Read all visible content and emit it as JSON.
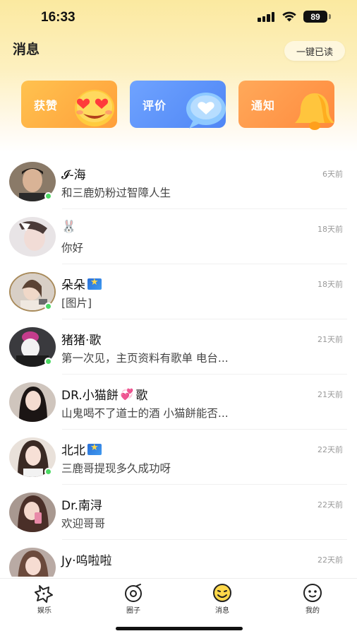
{
  "status_bar": {
    "time": "16:33",
    "battery": "89"
  },
  "header": {
    "title": "消息",
    "read_all_label": "一键已读"
  },
  "cards": [
    {
      "label": "获赞"
    },
    {
      "label": "评价"
    },
    {
      "label": "通知"
    }
  ],
  "conversations": [
    {
      "name": "𝓘-海",
      "message": "和三鹿奶粉过智障人生",
      "time": "6天前",
      "online": true
    },
    {
      "name": "🐰",
      "message": "你好",
      "time": "18天前",
      "online": false
    },
    {
      "name": "朵朵",
      "message": "[图片]",
      "time": "18天前",
      "online": true
    },
    {
      "name": "猪猪·歌",
      "message": "第一次见，主页资料有歌单 电台...",
      "time": "21天前",
      "online": true
    },
    {
      "name": "DR.小猫餅",
      "name_suffix": "歌",
      "message": "山鬼喝不了道士的酒 小猫餅能否...",
      "time": "21天前",
      "online": false
    },
    {
      "name": "北北",
      "message": "三鹿哥提现多久成功呀",
      "time": "22天前",
      "online": true
    },
    {
      "name": "Dr.南浔",
      "message": "欢迎哥哥",
      "time": "22天前",
      "online": false
    },
    {
      "name": "Jy·呜啦啦",
      "message": "",
      "time": "22天前",
      "online": false
    }
  ],
  "tabbar": [
    {
      "label": "娱乐",
      "icon": "star-chat-icon"
    },
    {
      "label": "圈子",
      "icon": "circle-icon"
    },
    {
      "label": "消息",
      "icon": "message-smile-icon",
      "active": true
    },
    {
      "label": "我的",
      "icon": "face-icon"
    }
  ],
  "colors": {
    "accent": "#ffd84a",
    "online": "#4cd964",
    "likes_card": "#ffb347",
    "reviews_card": "#5b8ff9",
    "notify_card": "#ff9a4a"
  }
}
